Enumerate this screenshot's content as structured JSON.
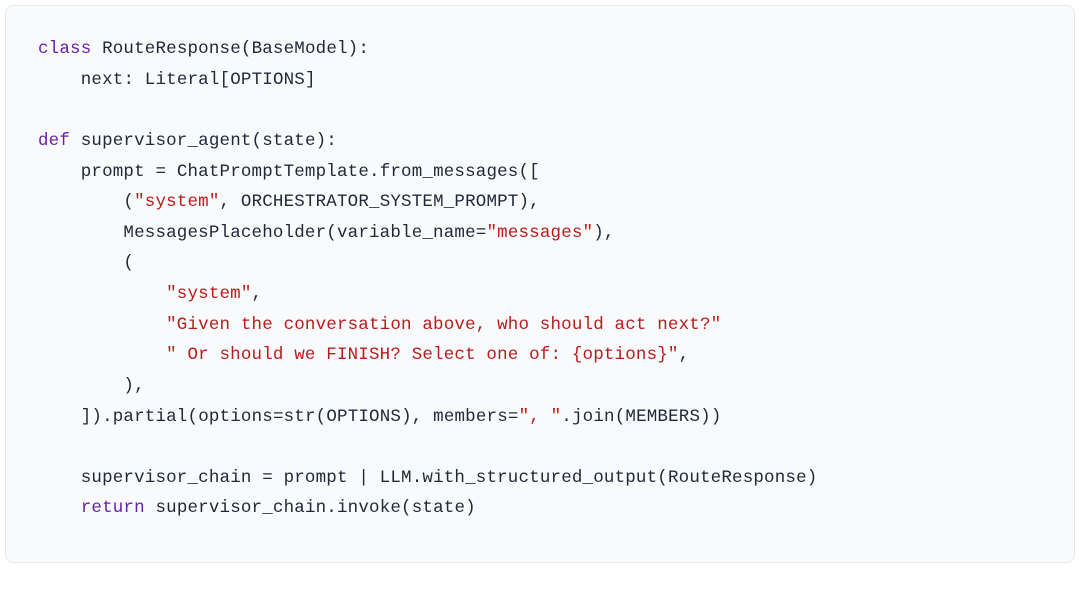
{
  "code": {
    "l1": {
      "kw_class": "class",
      "cls_name": "RouteResponse",
      "pn": "(",
      "base": "BaseModel",
      "pc": "):"
    },
    "l2": {
      "indent": "    ",
      "kw_next": "next",
      "colon": ": ",
      "literal": "Literal",
      "ob": "[",
      "opt": "OPTIONS",
      "cb": "]"
    },
    "l3": {
      "blank": " "
    },
    "l4": {
      "kw_def": "def",
      "fn_name": "supervisor_agent",
      "op": "(",
      "param": "state",
      "cp": "):"
    },
    "l5": {
      "indent": "    ",
      "var": "prompt",
      "eq": " = ",
      "cls": "ChatPromptTemplate",
      "dot": ".",
      "mth": "from_messages",
      "op": "(["
    },
    "l6": {
      "indent": "        ",
      "op": "(",
      "s1": "\"system\"",
      "comma": ", ",
      "id": "ORCHESTRATOR_SYSTEM_PROMPT",
      "cp": "),"
    },
    "l7": {
      "indent": "        ",
      "cls": "MessagesPlaceholder",
      "op": "(",
      "kw": "variable_name",
      "eq": "=",
      "s": "\"messages\"",
      "cp": "),"
    },
    "l8": {
      "indent": "        ",
      "op": "("
    },
    "l9": {
      "indent": "            ",
      "s": "\"system\"",
      "comma": ","
    },
    "l10": {
      "indent": "            ",
      "s": "\"Given the conversation above, who should act next?\""
    },
    "l11": {
      "indent": "            ",
      "s": "\" Or should we FINISH? Select one of: {options}\"",
      "comma": ","
    },
    "l12": {
      "indent": "        ",
      "cp": "),"
    },
    "l13": {
      "indent": "    ",
      "cb": "]).",
      "mth": "partial",
      "op": "(",
      "kw1": "options",
      "eq1": "=",
      "fn1": "str",
      "op1": "(",
      "id1": "OPTIONS",
      "cp1": ")",
      "comma": ", ",
      "kw2": "members",
      "eq2": "=",
      "s": "\", \"",
      "dot": ".",
      "mth2": "join",
      "op2": "(",
      "id2": "MEMBERS",
      "cp2": "))"
    },
    "l14": {
      "blank": " "
    },
    "l15": {
      "indent": "    ",
      "var": "supervisor_chain",
      "eq": " = ",
      "id1": "prompt",
      "pipe": " | ",
      "id2": "LLM",
      "dot": ".",
      "mth": "with_structured_output",
      "op": "(",
      "arg": "RouteResponse",
      "cp": ")"
    },
    "l16": {
      "indent": "    ",
      "kw_return": "return",
      "sp": " ",
      "var": "supervisor_chain",
      "dot": ".",
      "mth": "invoke",
      "op": "(",
      "arg": "state",
      "cp": ")"
    }
  }
}
